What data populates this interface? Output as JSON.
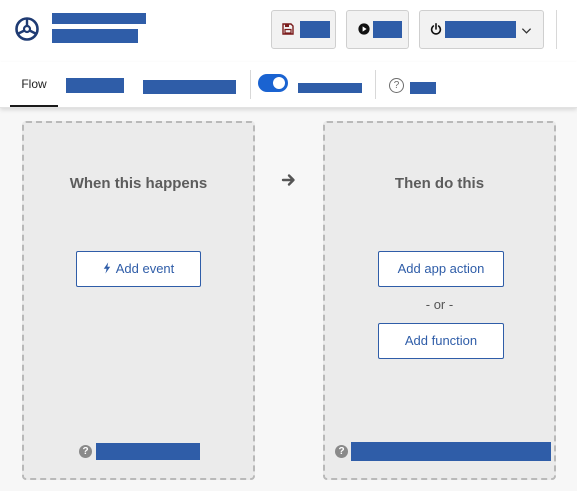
{
  "tabs": {
    "flow_label": "Flow"
  },
  "trigger_panel": {
    "title": "When this happens",
    "add_event_label": "Add event"
  },
  "action_panel": {
    "title": "Then do this",
    "add_app_action_label": "Add app action",
    "or_label": "- or -",
    "add_function_label": "Add function"
  },
  "icons": {
    "logo": "steering-wheel-logo-icon",
    "save": "save-icon",
    "test": "play-icon",
    "power": "power-icon",
    "dropdown": "chevron-down-icon",
    "help": "question-icon",
    "bolt": "lightning-bolt-icon",
    "arrow": "arrow-right-icon"
  },
  "colors": {
    "accent": "#2f5da8",
    "toggle": "#1a63d1"
  }
}
